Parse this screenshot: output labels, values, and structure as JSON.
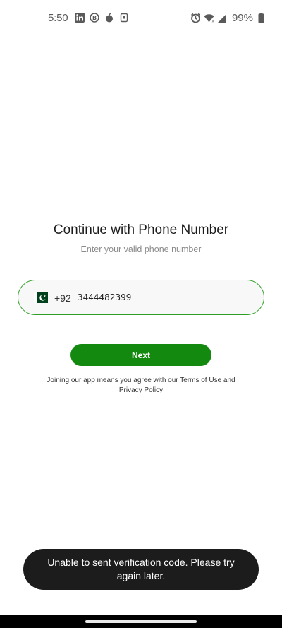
{
  "status_bar": {
    "time": "5:50",
    "left_icons": [
      "linkedin-icon",
      "bitcoin-icon",
      "fruit-icon",
      "notification-icon"
    ],
    "right_icons": [
      "alarm-icon",
      "wifi-icon",
      "signal-icon"
    ],
    "battery": "99%"
  },
  "login": {
    "title": "Continue with Phone Number",
    "subtitle": "Enter your valid phone number"
  },
  "phone": {
    "flag_icon": "pakistan-flag-icon",
    "country_code": "+92",
    "number": "3444482399"
  },
  "next_button": {
    "label": "Next"
  },
  "terms": {
    "line1": "Joining our app means you agree with our Terms of Use and",
    "line2": "Privacy Policy"
  },
  "toast": {
    "message": "Unable to sent verification code. Please try again later."
  },
  "colors": {
    "accent": "#138a0f",
    "field_border": "#2e9e25",
    "toast_bg": "#1c1c1c"
  }
}
